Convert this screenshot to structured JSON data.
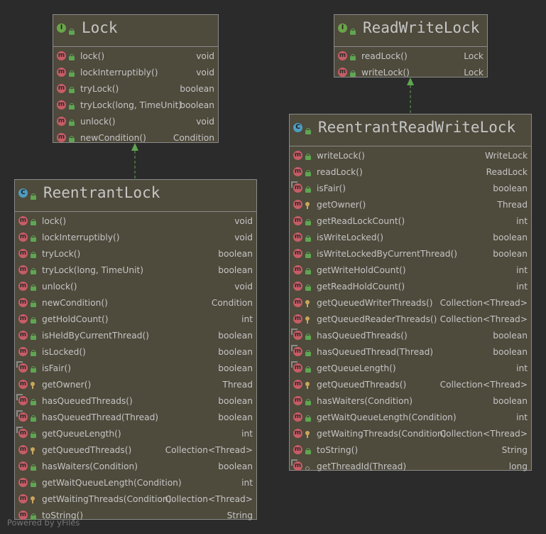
{
  "classes": {
    "lock": {
      "name": "Lock",
      "kind": "I",
      "methods": [
        {
          "name": "lock()",
          "type": "void",
          "vis": "pub",
          "ov": false
        },
        {
          "name": "lockInterruptibly()",
          "type": "void",
          "vis": "pub",
          "ov": false
        },
        {
          "name": "tryLock()",
          "type": "boolean",
          "vis": "pub",
          "ov": false
        },
        {
          "name": "tryLock(long, TimeUnit)",
          "type": "boolean",
          "vis": "pub",
          "ov": false
        },
        {
          "name": "unlock()",
          "type": "void",
          "vis": "pub",
          "ov": false
        },
        {
          "name": "newCondition()",
          "type": "Condition",
          "vis": "pub",
          "ov": false
        }
      ]
    },
    "rwlock": {
      "name": "ReadWriteLock",
      "kind": "I",
      "methods": [
        {
          "name": "readLock()",
          "type": "Lock",
          "vis": "pub",
          "ov": false
        },
        {
          "name": "writeLock()",
          "type": "Lock",
          "vis": "pub",
          "ov": false
        }
      ]
    },
    "reentrant": {
      "name": "ReentrantLock",
      "kind": "C",
      "methods": [
        {
          "name": "lock()",
          "type": "void",
          "vis": "pub",
          "ov": false
        },
        {
          "name": "lockInterruptibly()",
          "type": "void",
          "vis": "pub",
          "ov": false
        },
        {
          "name": "tryLock()",
          "type": "boolean",
          "vis": "pub",
          "ov": false
        },
        {
          "name": "tryLock(long, TimeUnit)",
          "type": "boolean",
          "vis": "pub",
          "ov": false
        },
        {
          "name": "unlock()",
          "type": "void",
          "vis": "pub",
          "ov": false
        },
        {
          "name": "newCondition()",
          "type": "Condition",
          "vis": "pub",
          "ov": false
        },
        {
          "name": "getHoldCount()",
          "type": "int",
          "vis": "pub",
          "ov": false
        },
        {
          "name": "isHeldByCurrentThread()",
          "type": "boolean",
          "vis": "pub",
          "ov": false
        },
        {
          "name": "isLocked()",
          "type": "boolean",
          "vis": "pub",
          "ov": false
        },
        {
          "name": "isFair()",
          "type": "boolean",
          "vis": "pub",
          "ov": true
        },
        {
          "name": "getOwner()",
          "type": "Thread",
          "vis": "prot",
          "ov": false
        },
        {
          "name": "hasQueuedThreads()",
          "type": "boolean",
          "vis": "pub",
          "ov": true
        },
        {
          "name": "hasQueuedThread(Thread)",
          "type": "boolean",
          "vis": "pub",
          "ov": true
        },
        {
          "name": "getQueueLength()",
          "type": "int",
          "vis": "pub",
          "ov": true
        },
        {
          "name": "getQueuedThreads()",
          "type": "Collection<Thread>",
          "vis": "prot",
          "ov": false
        },
        {
          "name": "hasWaiters(Condition)",
          "type": "boolean",
          "vis": "pub",
          "ov": false
        },
        {
          "name": "getWaitQueueLength(Condition)",
          "type": "int",
          "vis": "pub",
          "ov": false
        },
        {
          "name": "getWaitingThreads(Condition)",
          "type": "Collection<Thread>",
          "vis": "prot",
          "ov": false
        },
        {
          "name": "toString()",
          "type": "String",
          "vis": "pub",
          "ov": false
        }
      ]
    },
    "rrwlock": {
      "name": "ReentrantReadWriteLock",
      "kind": "C",
      "methods": [
        {
          "name": "writeLock()",
          "type": "WriteLock",
          "vis": "pub",
          "ov": false
        },
        {
          "name": "readLock()",
          "type": "ReadLock",
          "vis": "pub",
          "ov": false
        },
        {
          "name": "isFair()",
          "type": "boolean",
          "vis": "pub",
          "ov": true
        },
        {
          "name": "getOwner()",
          "type": "Thread",
          "vis": "prot",
          "ov": false
        },
        {
          "name": "getReadLockCount()",
          "type": "int",
          "vis": "pub",
          "ov": false
        },
        {
          "name": "isWriteLocked()",
          "type": "boolean",
          "vis": "pub",
          "ov": false
        },
        {
          "name": "isWriteLockedByCurrentThread()",
          "type": "boolean",
          "vis": "pub",
          "ov": false
        },
        {
          "name": "getWriteHoldCount()",
          "type": "int",
          "vis": "pub",
          "ov": false
        },
        {
          "name": "getReadHoldCount()",
          "type": "int",
          "vis": "pub",
          "ov": false
        },
        {
          "name": "getQueuedWriterThreads()",
          "type": "Collection<Thread>",
          "vis": "prot",
          "ov": false
        },
        {
          "name": "getQueuedReaderThreads()",
          "type": "Collection<Thread>",
          "vis": "prot",
          "ov": false
        },
        {
          "name": "hasQueuedThreads()",
          "type": "boolean",
          "vis": "pub",
          "ov": true
        },
        {
          "name": "hasQueuedThread(Thread)",
          "type": "boolean",
          "vis": "pub",
          "ov": true
        },
        {
          "name": "getQueueLength()",
          "type": "int",
          "vis": "pub",
          "ov": true
        },
        {
          "name": "getQueuedThreads()",
          "type": "Collection<Thread>",
          "vis": "prot",
          "ov": false
        },
        {
          "name": "hasWaiters(Condition)",
          "type": "boolean",
          "vis": "pub",
          "ov": false
        },
        {
          "name": "getWaitQueueLength(Condition)",
          "type": "int",
          "vis": "pub",
          "ov": false
        },
        {
          "name": "getWaitingThreads(Condition)",
          "type": "Collection<Thread>",
          "vis": "prot",
          "ov": false
        },
        {
          "name": "toString()",
          "type": "String",
          "vis": "pub",
          "ov": false
        },
        {
          "name": "getThreadId(Thread)",
          "type": "long",
          "vis": "pkg",
          "ov": true
        }
      ]
    }
  },
  "footer": "Powered by yFiles",
  "colors": {
    "background": "#2b2b2b",
    "node": "#4e4a3c",
    "method_icon": "#c65d66",
    "interface_icon": "#6aa549",
    "class_icon": "#4e9cc0",
    "arrow": "#5fa552"
  }
}
